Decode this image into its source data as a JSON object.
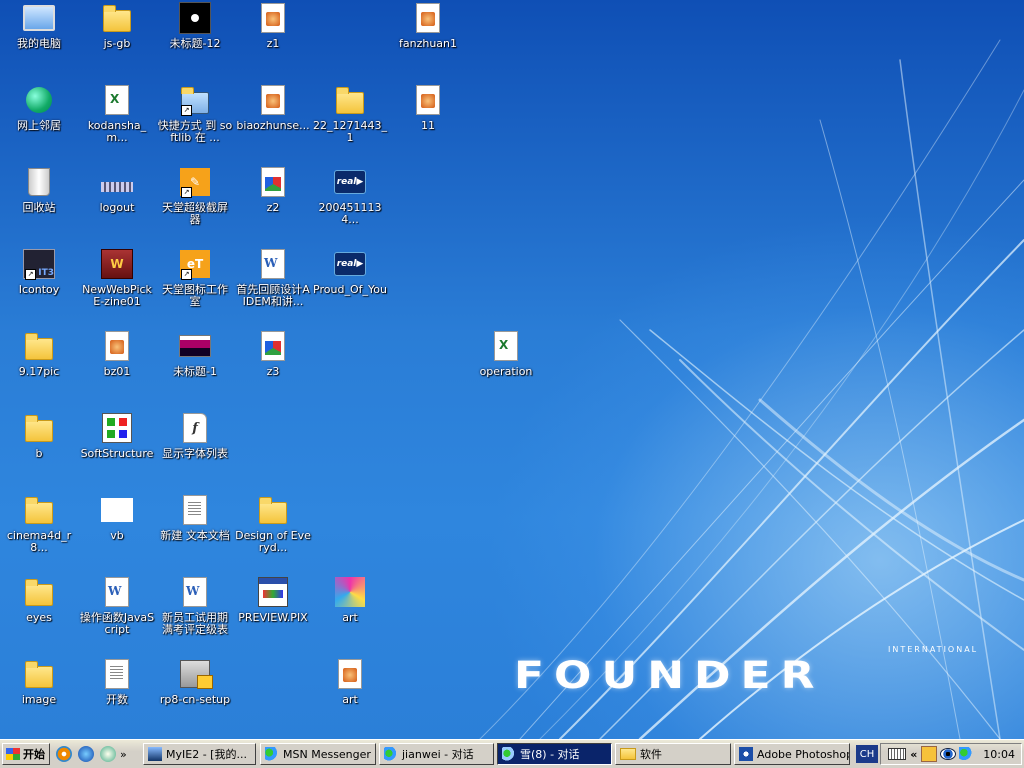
{
  "desktop": {
    "icons": [
      {
        "label": "我的电脑",
        "icon": "my-computer-icon"
      },
      {
        "label": "js-gb",
        "icon": "folder-icon"
      },
      {
        "label": "未标题-12",
        "icon": "image-black-icon"
      },
      {
        "label": "z1",
        "icon": "image-file-icon"
      },
      {
        "label": "fanzhuan1",
        "icon": "image-file-icon"
      },
      {
        "label": "网上邻居",
        "icon": "network-places-icon"
      },
      {
        "label": "kodansha_m...",
        "icon": "excel-file-icon"
      },
      {
        "label": "快捷方式 到 softlib 在 ...",
        "icon": "shortcut-network-icon"
      },
      {
        "label": "biaozhunse...",
        "icon": "image-file-icon"
      },
      {
        "label": "22_1271443_1",
        "icon": "folder-icon"
      },
      {
        "label": "11",
        "icon": "image-file-icon"
      },
      {
        "label": "回收站",
        "icon": "recycle-bin-icon"
      },
      {
        "label": "logout",
        "icon": "bar-image-icon"
      },
      {
        "label": "天堂超级截屏器",
        "icon": "screenshot-tool-icon"
      },
      {
        "label": "z2",
        "icon": "z-file-icon"
      },
      {
        "label": "2004511134...",
        "icon": "real-media-icon"
      },
      {
        "label": "Icontoy",
        "icon": "icontoy-icon"
      },
      {
        "label": "NewWebPickE-zine01",
        "icon": "webpick-icon"
      },
      {
        "label": "天堂图标工作室",
        "icon": "icon-studio-icon"
      },
      {
        "label": "首先回顾设计AIDEM和讲...",
        "icon": "word-file-icon"
      },
      {
        "label": "Proud_Of_You",
        "icon": "real-media-icon"
      },
      {
        "label": "9.17pic",
        "icon": "folder-icon"
      },
      {
        "label": "bz01",
        "icon": "image-file-icon"
      },
      {
        "label": "未标题-1",
        "icon": "strip-image-icon"
      },
      {
        "label": "z3",
        "icon": "z-file-icon"
      },
      {
        "label": "operation",
        "icon": "excel-file-icon"
      },
      {
        "label": "b",
        "icon": "folder-icon"
      },
      {
        "label": "SoftStructure",
        "icon": "softstructure-icon"
      },
      {
        "label": "显示字体列表",
        "icon": "font-file-icon"
      },
      {
        "label": "cinema4d_r8...",
        "icon": "folder-icon"
      },
      {
        "label": "vb",
        "icon": "blank-image-icon"
      },
      {
        "label": "新建 文本文档",
        "icon": "text-file-icon"
      },
      {
        "label": "Design of Everyd...",
        "icon": "folder-icon"
      },
      {
        "label": "eyes",
        "icon": "folder-icon"
      },
      {
        "label": "操作函数JavaScript",
        "icon": "word-file-icon"
      },
      {
        "label": "新员工试用期满考评定级表",
        "icon": "word-file-icon"
      },
      {
        "label": "PREVIEW.PIX",
        "icon": "pix-file-icon"
      },
      {
        "label": "art",
        "icon": "art-image-icon"
      },
      {
        "label": "image",
        "icon": "folder-icon"
      },
      {
        "label": "开数",
        "icon": "text-file-icon"
      },
      {
        "label": "rp8-cn-setup",
        "icon": "setup-icon"
      },
      {
        "label": "art",
        "icon": "image-file-icon"
      }
    ]
  },
  "wallpaper": {
    "brand": "FOUNDER",
    "brand_sub": "INTERNATIONAL",
    "base_color": "#2a7dd6"
  },
  "taskbar": {
    "start_label": "开始",
    "tasks": [
      {
        "label": "MyIE2 - [我的...",
        "icon": "browser-icon"
      },
      {
        "label": "MSN Messenger",
        "icon": "msn-icon"
      },
      {
        "label": "jianwei - 对话",
        "icon": "chat-icon"
      },
      {
        "label": "雪(8) - 对话",
        "icon": "chat-icon"
      },
      {
        "label": "软件",
        "icon": "folder-icon"
      },
      {
        "label": "Adobe Photoshop",
        "icon": "photoshop-icon"
      }
    ],
    "active_task": "雪(8) - 对话",
    "language": "CH",
    "expand_label": "«",
    "quicklaunch_more": "»",
    "clock": "10:04"
  }
}
